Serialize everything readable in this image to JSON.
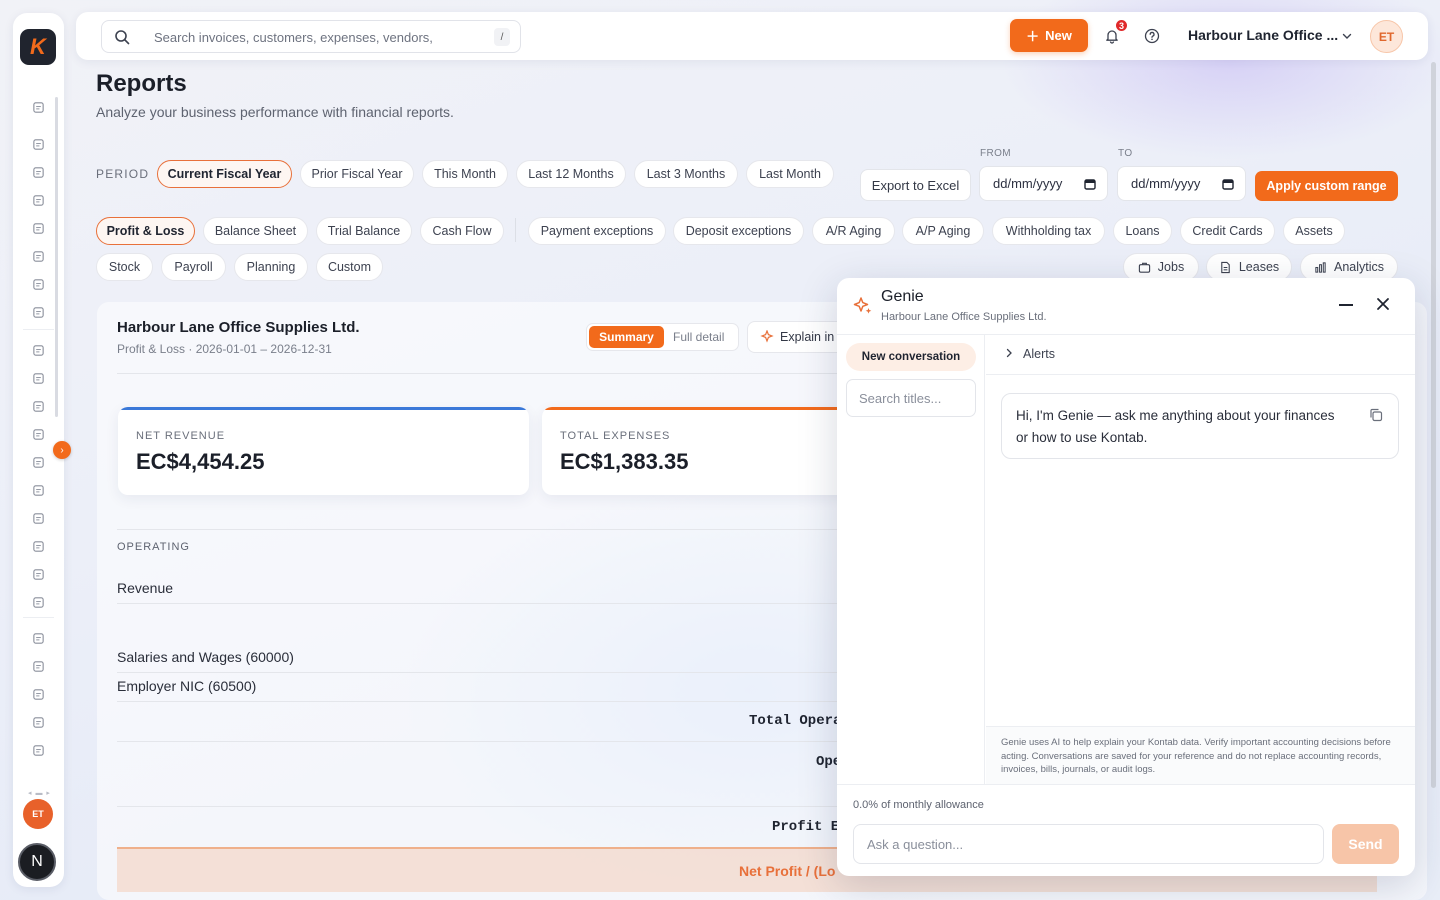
{
  "sidebar": {
    "logo_letter": "K",
    "nav_icons": [
      "home-icon",
      "team-icon",
      "box-icon",
      "document-icon",
      "invoice-icon",
      "report-icon",
      "clock-icon",
      "file-icon",
      "bank-icon",
      "copy-icon",
      "refresh-icon",
      "receipt-icon",
      "card-icon",
      "sync-icon",
      "cart-icon",
      "bill-icon",
      "list-icon",
      "truck-icon",
      "monitor-icon",
      "monitor-icon",
      "send-icon",
      "monitor-icon",
      "card-icon"
    ],
    "avatar_initials": "ET",
    "workspace_initial": "N"
  },
  "topbar": {
    "search_placeholder": "Search invoices, customers, expenses, vendors,",
    "search_shortcut": "/",
    "new_label": "New",
    "notification_count": "3",
    "org_name": "Harbour Lane Office ...",
    "avatar_initials": "ET",
    "accent_color": "#f26a1b"
  },
  "page": {
    "title": "Reports",
    "subtitle": "Analyze your business performance with financial reports."
  },
  "period": {
    "label": "PERIOD",
    "options": [
      "Current Fiscal Year",
      "Prior Fiscal Year",
      "This Month",
      "Last 12 Months",
      "Last 3 Months",
      "Last Month"
    ],
    "selected": "Current Fiscal Year",
    "export_label": "Export to Excel",
    "from_label": "FROM",
    "to_label": "TO",
    "from_value": "dd/mm/yyyy",
    "to_value": "dd/mm/yyyy",
    "apply_label": "Apply custom range"
  },
  "report_types": {
    "row1": [
      "Profit & Loss",
      "Balance Sheet",
      "Trial Balance",
      "Cash Flow",
      "Payment exceptions",
      "Deposit exceptions",
      "A/R Aging",
      "A/P Aging",
      "Withholding tax",
      "Loans",
      "Credit Cards",
      "Assets"
    ],
    "row2": [
      "Stock",
      "Payroll",
      "Planning",
      "Custom"
    ],
    "row2_right": [
      "Jobs",
      "Leases",
      "Analytics"
    ],
    "selected": "Profit & Loss"
  },
  "report": {
    "company": "Harbour Lane Office Supplies Ltd.",
    "meta": "Profit & Loss · 2026-01-01 – 2026-12-31",
    "view_summary": "Summary",
    "view_full": "Full detail",
    "explain_label": "Explain in",
    "kpis": [
      {
        "label": "NET REVENUE",
        "value": "EC$4,454.25",
        "color": "#3a78d8"
      },
      {
        "label": "TOTAL EXPENSES",
        "value": "EC$1,383.35",
        "color": "#f26a1b"
      }
    ],
    "section": "OPERATING",
    "rows": [
      "Revenue",
      "Salaries and Wages (60000)",
      "Employer NIC (60500)"
    ],
    "total_operating": "Total Opera",
    "operating_short": "Ope",
    "profit_short": "Profit E",
    "net_profit_label": "Net Profit / (Lo"
  },
  "genie": {
    "title": "Genie",
    "subtitle": "Harbour Lane Office Supplies Ltd.",
    "new_conversation": "New conversation",
    "search_placeholder": "Search titles...",
    "alerts_label": "Alerts",
    "greeting": "Hi, I'm Genie — ask me anything about your finances or how to use Kontab.",
    "disclaimer": "Genie uses AI to help explain your Kontab data. Verify important accounting decisions before acting. Conversations are saved for your reference and do not replace accounting records, invoices, bills, journals, or audit logs.",
    "allowance": "0.0% of monthly allowance",
    "ask_placeholder": "Ask a question...",
    "send_label": "Send"
  }
}
